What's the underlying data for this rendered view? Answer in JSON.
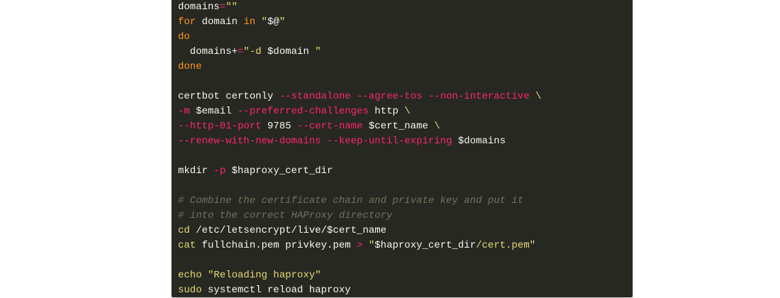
{
  "code": {
    "lines": [
      [
        {
          "t": "domains",
          "c": "plain"
        },
        {
          "t": "=",
          "c": "op"
        },
        {
          "t": "\"\"",
          "c": "str"
        }
      ],
      [
        {
          "t": "for",
          "c": "kw"
        },
        {
          "t": " domain ",
          "c": "plain"
        },
        {
          "t": "in",
          "c": "kw"
        },
        {
          "t": " ",
          "c": "plain"
        },
        {
          "t": "\"",
          "c": "str"
        },
        {
          "t": "$@",
          "c": "plain"
        },
        {
          "t": "\"",
          "c": "str"
        }
      ],
      [
        {
          "t": "do",
          "c": "kw"
        }
      ],
      [
        {
          "t": "  domains+",
          "c": "plain"
        },
        {
          "t": "=",
          "c": "op"
        },
        {
          "t": "\"-d ",
          "c": "str"
        },
        {
          "t": "$domain",
          "c": "plain"
        },
        {
          "t": " \"",
          "c": "str"
        }
      ],
      [
        {
          "t": "done",
          "c": "kw"
        }
      ],
      [],
      [
        {
          "t": "certbot certonly ",
          "c": "plain"
        },
        {
          "t": "--standalone",
          "c": "flag"
        },
        {
          "t": " ",
          "c": "plain"
        },
        {
          "t": "--agree-tos",
          "c": "flag"
        },
        {
          "t": " ",
          "c": "plain"
        },
        {
          "t": "--non-interactive",
          "c": "flag"
        },
        {
          "t": " ",
          "c": "plain"
        },
        {
          "t": "\\",
          "c": "str"
        }
      ],
      [
        {
          "t": "-m",
          "c": "flag"
        },
        {
          "t": " $email ",
          "c": "plain"
        },
        {
          "t": "--preferred-challenges",
          "c": "flag"
        },
        {
          "t": " http ",
          "c": "plain"
        },
        {
          "t": "\\",
          "c": "str"
        }
      ],
      [
        {
          "t": "--http-01-port",
          "c": "flag"
        },
        {
          "t": " 9785 ",
          "c": "plain"
        },
        {
          "t": "--cert-name",
          "c": "flag"
        },
        {
          "t": " $cert_name ",
          "c": "plain"
        },
        {
          "t": "\\",
          "c": "str"
        }
      ],
      [
        {
          "t": "--renew-with-new-domains",
          "c": "flag"
        },
        {
          "t": " ",
          "c": "plain"
        },
        {
          "t": "--keep-until-expiring",
          "c": "flag"
        },
        {
          "t": " $domains",
          "c": "plain"
        }
      ],
      [],
      [
        {
          "t": "mkdir ",
          "c": "plain"
        },
        {
          "t": "-p",
          "c": "flag"
        },
        {
          "t": " $haproxy_cert_dir",
          "c": "plain"
        }
      ],
      [],
      [
        {
          "t": "# Combine the certificate chain and private key and put it",
          "c": "comment"
        }
      ],
      [
        {
          "t": "# into the correct HAProxy directory",
          "c": "comment"
        }
      ],
      [
        {
          "t": "cd",
          "c": "builtin"
        },
        {
          "t": " /etc/letsencrypt/live/$cert_name",
          "c": "plain"
        }
      ],
      [
        {
          "t": "cat",
          "c": "builtin"
        },
        {
          "t": " fullchain.pem privkey.pem ",
          "c": "plain"
        },
        {
          "t": ">",
          "c": "op"
        },
        {
          "t": " ",
          "c": "plain"
        },
        {
          "t": "\"",
          "c": "str"
        },
        {
          "t": "$haproxy_cert_dir",
          "c": "plain"
        },
        {
          "t": "/cert.pem\"",
          "c": "str"
        }
      ],
      [],
      [
        {
          "t": "echo",
          "c": "builtin"
        },
        {
          "t": " ",
          "c": "plain"
        },
        {
          "t": "\"Reloading haproxy\"",
          "c": "str"
        }
      ],
      [
        {
          "t": "sudo",
          "c": "builtin"
        },
        {
          "t": " systemctl reload haproxy",
          "c": "plain"
        }
      ]
    ]
  },
  "colors": {
    "background": "#272822",
    "plain": "#f8f8f2",
    "keyword": "#fd971f",
    "string": "#e6db74",
    "flag": "#f92672",
    "comment": "#75715e"
  }
}
